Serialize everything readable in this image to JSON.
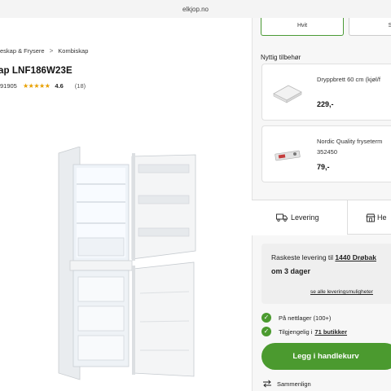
{
  "browser": {
    "url": "elkjop.no"
  },
  "breadcrumb": {
    "items": [
      "eskap & Frysere",
      "Kombiskap"
    ],
    "separator": ">"
  },
  "product": {
    "title": "ap LNF186W23E",
    "sku_fragment": "91905",
    "stars": "★★★★★",
    "rating": "4.6",
    "review_count": "(18)"
  },
  "variants": [
    {
      "label": "Hvit",
      "selected": true
    },
    {
      "label": "S",
      "selected": false
    }
  ],
  "accessories": {
    "heading": "Nyttig tilbehør",
    "items": [
      {
        "name": "Dryppbrett 60 cm (kjøl/f",
        "sub": "",
        "price": "229,-"
      },
      {
        "name": "Nordic Quality fryseterm",
        "sub": "352450",
        "price": "79,-"
      }
    ]
  },
  "tabs": [
    {
      "label": "Levering",
      "icon": "truck-icon",
      "active": true
    },
    {
      "label": "He",
      "icon": "store-icon",
      "active": false
    }
  ],
  "delivery": {
    "line1_prefix": "Raskeste levering til ",
    "line1_link": "1440 Drøbak",
    "line2": "om 3 dager",
    "options_link": "se alle leveringsmuligheter"
  },
  "stock": {
    "online": "På nettlager (100+)",
    "stores_prefix": "Tilgjengelig i ",
    "stores_link": "71 butikker"
  },
  "cart_button": "Legg i handlekurv",
  "compare": "Sammenlign",
  "colors": {
    "accent": "#4b9a2f",
    "star": "#e8a000"
  }
}
